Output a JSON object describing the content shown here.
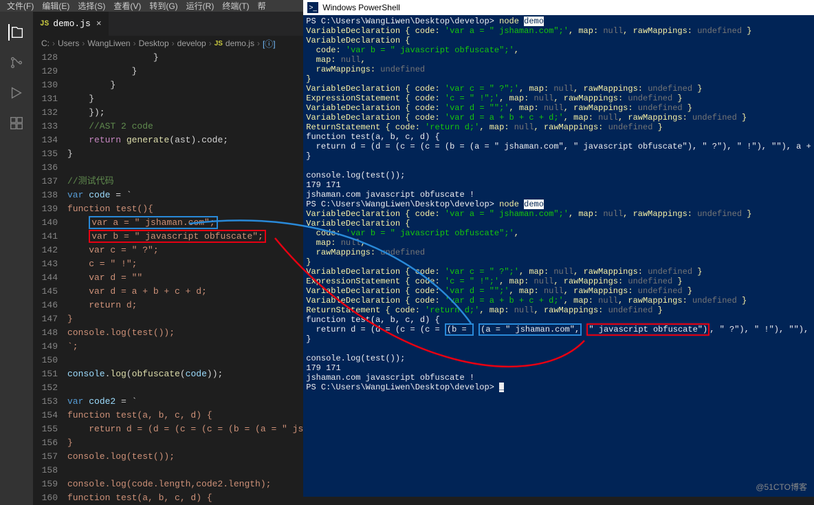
{
  "menubar": {
    "file": "文件(F)",
    "edit": "编辑(E)",
    "select": "选择(S)",
    "view": "查看(V)",
    "goto": "转到(G)",
    "run": "运行(R)",
    "terminal": "终端(T)",
    "help": "帮"
  },
  "tab": {
    "icon": "JS",
    "name": "demo.js",
    "close": "×"
  },
  "breadcrumbs": {
    "parts": [
      "C:",
      "Users",
      "WangLiwen",
      "Desktop",
      "develop"
    ],
    "file": "demo.js",
    "symbol_icon": "[ⓘ]"
  },
  "gutter_start": 128,
  "gutter_end": 160,
  "code": {
    "l128": "                }",
    "l129": "            }",
    "l130": "        }",
    "l131": "    }",
    "l132": "});",
    "l133_comment": "//AST 2 code",
    "l134_return": "return",
    "l134_fn": "generate",
    "l134_arg": "(ast).code;",
    "l135": "}",
    "l137_comment": "//测试代码",
    "l138_var": "var",
    "l138_name": "code",
    "l138_eq": " = `",
    "l139_fn": "function",
    "l139_name": "test",
    "l139_rest": "(){",
    "l140_var": "var a = ",
    "l140_str": "\" jshaman.com\"",
    "l140_sc": ";",
    "l141_var": "var b = ",
    "l141_str": "\" javascript obfuscate\"",
    "l141_sc": ";",
    "l142_var": "var c = ",
    "l142_str": "\" ?\"",
    "l142_sc": ";",
    "l143_c": "c = ",
    "l143_str": "\" !\"",
    "l143_sc": ";",
    "l144_var": "var d = ",
    "l144_str": "\"\"",
    "l145_var": "var d = a + b + c + d;",
    "l146": "return d;",
    "l147": "}",
    "l148": "console.log(test());",
    "l149": "`;",
    "l151": "console.log(obfuscate(code));",
    "l153_var": "var",
    "l153_name": "code2",
    "l153_eq": " = `",
    "l154": "function test(a, b, c, d) {",
    "l155": "    return d = (d = (c = (c = (b = (a = \" js",
    "l156": "}",
    "l157": "console.log(test());",
    "l158": "",
    "l159": "console.log(code.length,code2.length);",
    "l160": "function test(a, b, c, d) {"
  },
  "ps": {
    "title_icon": ">_",
    "title": "Windows PowerShell",
    "prompt_path": "PS C:\\Users\\WangLiwen\\Desktop\\develop>",
    "node": "node",
    "demo": "demo",
    "vd1": "VariableDeclaration { code: ",
    "vd1_s": "'var a = \" jshaman.com\";'",
    "map_null": ", map: ",
    "nul": "null",
    "raw": ", rawMappings: ",
    "undef": "undefined",
    "close": " }",
    "vd_open": "VariableDeclaration {",
    "code_lbl": "  code: ",
    "vdb_s": "'var b = \" javascript obfuscate\";'",
    "comma": ",",
    "map_lbl": "  map: ",
    "raw_lbl": "  rawMappings: ",
    "brace": "}",
    "vdc_s": "'var c = \" ?\";'",
    "es": "ExpressionStatement { code: ",
    "es_s": "'c = \" !\";'",
    "vdd1_s": "'var d = \"\";'",
    "vdd2_s": "'var d = a + b + c + d;'",
    "rs": "ReturnStatement { code: ",
    "rs_s": "'return d;'",
    "fn_sig": "function test(a, b, c, d) {",
    "ret_line1": "  return d = (d = (c = (c = (b = (a = \" jshaman.com\", \" javascript obfuscate\"), \" ?\"), \" !\"), \"\"), a + b",
    "ret_line2_a": "  return d = (d = (c = (c = ",
    "ret_line2_b": "(b = ",
    "ret_line2_c": "(a = \" jshaman.com\",",
    "ret_line2_d": "\" javascript obfuscate\")",
    "ret_line2_e": ", \" ?\"), \" !\"), \"\"), a + b",
    "clog": "console.log(test());",
    "nums": "179 171",
    "result": "jshaman.com javascript obfuscate !",
    "cursor": "_"
  },
  "watermark": "@51CTO博客"
}
